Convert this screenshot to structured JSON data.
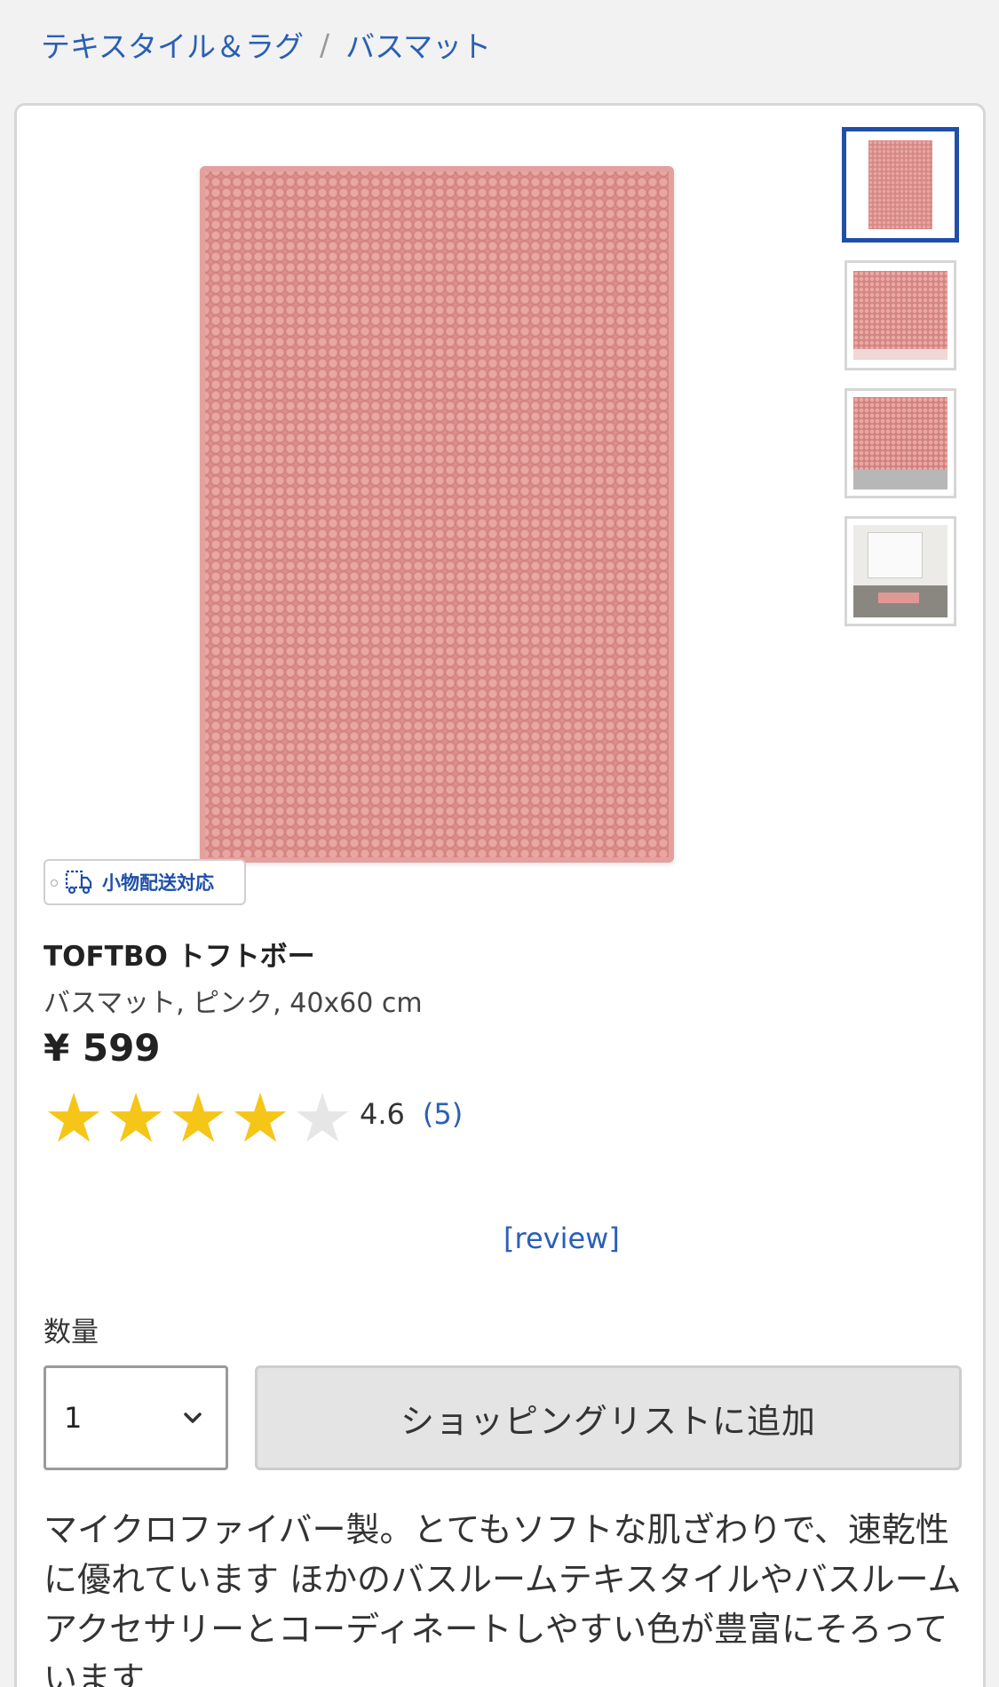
{
  "breadcrumb": {
    "items": [
      "テキスタイル＆ラグ",
      "バスマット"
    ],
    "separator": "/"
  },
  "product": {
    "badge_label": "小物配送対応",
    "title": "TOFTBO トフトボー",
    "subtitle": "バスマット, ピンク, 40x60 cm",
    "price": "¥ 599",
    "rating": {
      "value": "4.6",
      "count": "(5)",
      "stars_filled": 4,
      "stars_total": 5
    },
    "review_link": "[review]",
    "image_alt": "pink bath mat",
    "thumbnails": [
      "pink-mat-top",
      "pink-mat-corner",
      "pink-mat-folded",
      "mat-in-bathroom"
    ],
    "selected_thumbnail": 0
  },
  "purchase": {
    "quantity_label": "数量",
    "quantity_value": "1",
    "add_button_label": "ショッピングリストに追加"
  },
  "description": "マイクロファイバー製。とてもソフトな肌ざわりで、速乾性に優れています ほかのバスルームテキスタイルやバスルームアクセサリーとコーディネートしやすい色が豊富にそろっています",
  "colors": {
    "link": "#2a5fb5",
    "accent": "#1f4fa8",
    "star": "#f5c518",
    "mat_pink": "#dc8f8c"
  }
}
